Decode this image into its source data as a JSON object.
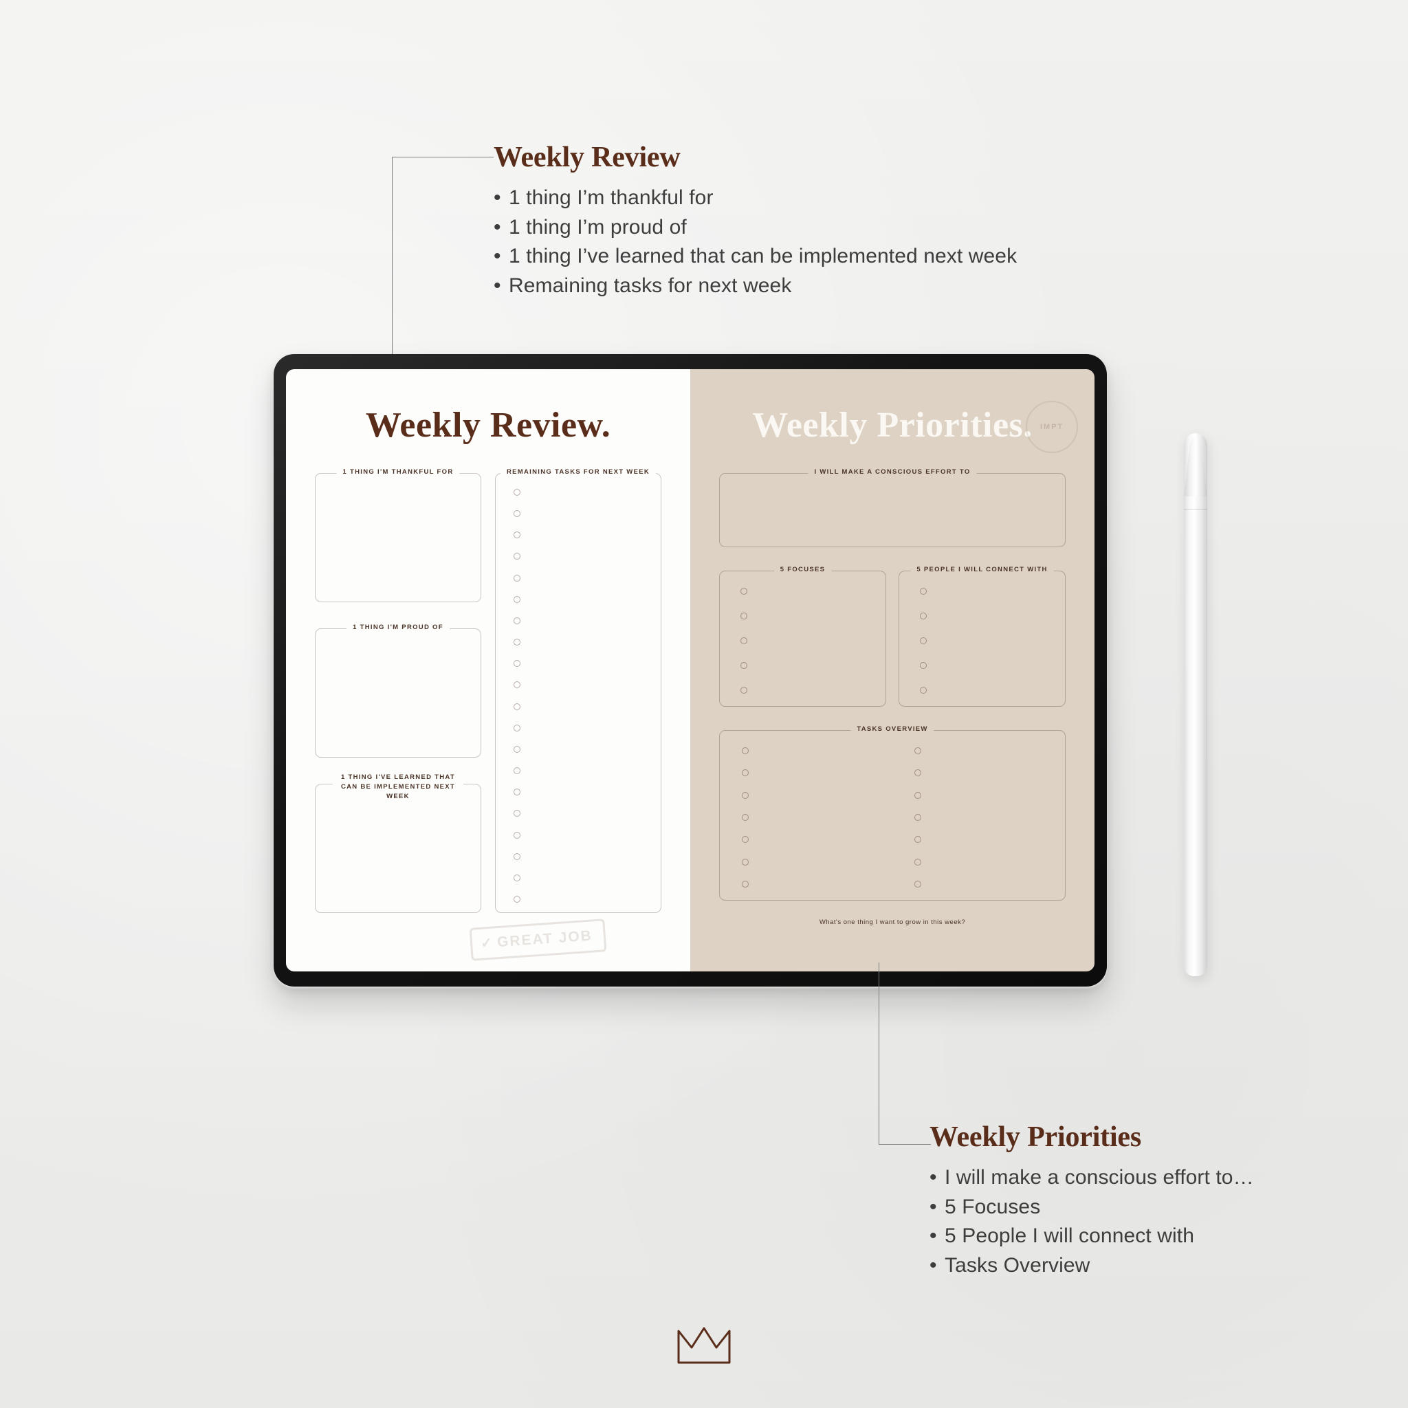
{
  "annotations": {
    "top": {
      "title": "Weekly Review",
      "bullets": [
        "1 thing I’m thankful for",
        "1 thing I’m proud of",
        "1 thing I’ve learned that can be implemented next week",
        "Remaining tasks for next week"
      ]
    },
    "bottom": {
      "title": "Weekly Priorities",
      "bullets": [
        "I will make a conscious effort to…",
        "5 Focuses",
        "5 People I will connect with",
        "Tasks Overview"
      ]
    }
  },
  "tablet": {
    "left_page": {
      "title": "Weekly Review.",
      "boxes": [
        {
          "label": "1 THING I'M THANKFUL FOR"
        },
        {
          "label": "1 THING I'M PROUD OF"
        },
        {
          "label": "1 THING I'VE LEARNED THAT CAN BE IMPLEMENTED NEXT WEEK"
        }
      ],
      "tasks_box_label": "REMAINING TASKS FOR NEXT WEEK",
      "tasks_checkbox_count": 20,
      "stamp": "GREAT JOB"
    },
    "right_page": {
      "title": "Weekly Priorities.",
      "effort_label": "I WILL MAKE A CONSCIOUS EFFORT TO",
      "focuses_label": "5 FOCUSES",
      "focuses_count": 5,
      "people_label": "5 PEOPLE I WILL CONNECT WITH",
      "people_count": 5,
      "tasks_label": "TASKS OVERVIEW",
      "tasks_rows": 7,
      "footer_question": "What's one thing I want to grow in this week?",
      "stamp": "IMPT"
    }
  },
  "colors": {
    "background": "#efefed",
    "brown": "#5a2d1a",
    "beige": "#ddd2c4",
    "cream": "#fbf8f3",
    "body_text": "#3d3d3d"
  },
  "icons": {
    "crown": "crown-icon",
    "pencil": "stylus-pencil",
    "checkbox": "circle-checkbox"
  }
}
